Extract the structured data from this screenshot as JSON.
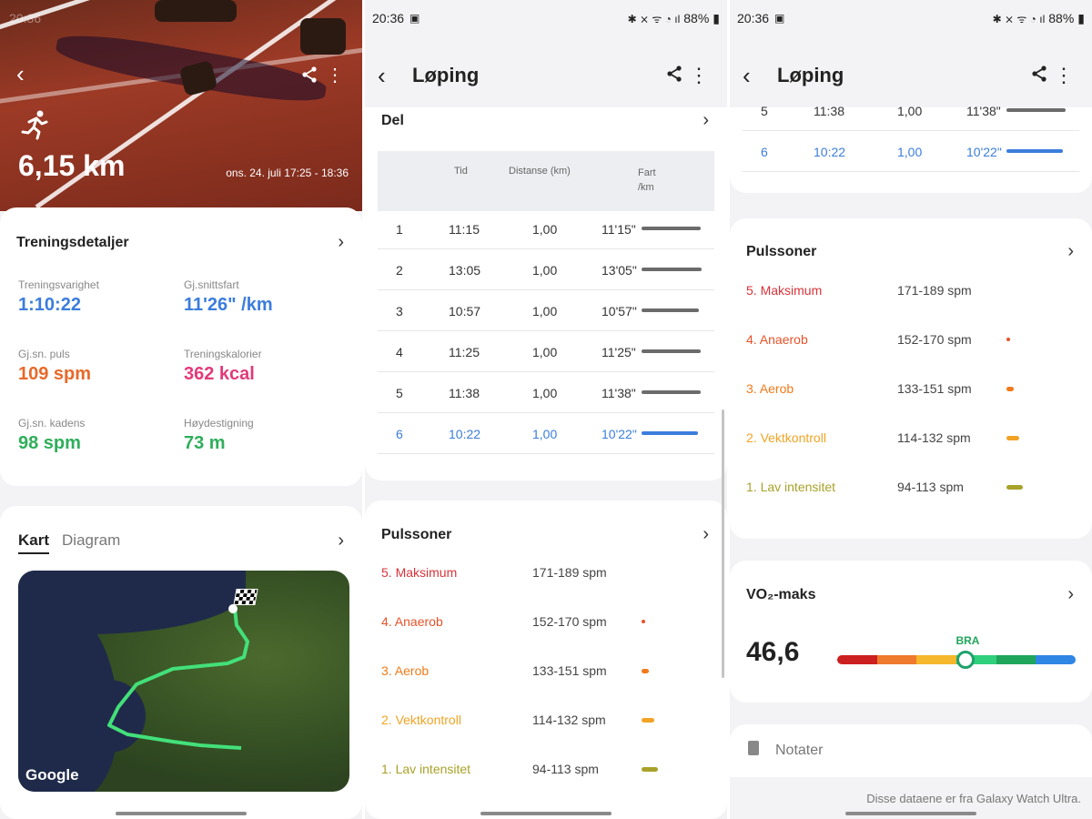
{
  "status_bar": {
    "time": "20:36",
    "battery": "88%"
  },
  "panel1": {
    "distance": "6,15 km",
    "datetime": "ons. 24. juli 17:25 - 18:36",
    "details_title": "Treningsdetaljer",
    "stats": [
      {
        "label": "Treningsvarighet",
        "value": "1:10:22",
        "color": "#3b7ddd"
      },
      {
        "label": "Gj.snittsfart",
        "value": "11'26\" /km",
        "color": "#3b7ddd"
      },
      {
        "label": "Gj.sn. puls",
        "value": "109 spm",
        "color": "#e8692a"
      },
      {
        "label": "Treningskalorier",
        "value": "362 kcal",
        "color": "#e23a7a"
      },
      {
        "label": "Gj.sn. kadens",
        "value": "98 spm",
        "color": "#2fae5b"
      },
      {
        "label": "Høydestigning",
        "value": "73 m",
        "color": "#2fae5b"
      }
    ],
    "tabs": [
      "Kart",
      "Diagram"
    ],
    "map_attribution": "Google"
  },
  "panel2": {
    "title": "Løping",
    "splits_title": "Del",
    "columns": [
      "Tid",
      "Distanse (km)",
      "Fart /km"
    ],
    "splits": [
      {
        "n": "1",
        "tid": "11:15",
        "dist": "1,00",
        "fart": "11'15\"",
        "pace_fraction": 0.85
      },
      {
        "n": "2",
        "tid": "13:05",
        "dist": "1,00",
        "fart": "13'05\"",
        "pace_fraction": 0.87
      },
      {
        "n": "3",
        "tid": "10:57",
        "dist": "1,00",
        "fart": "10'57\"",
        "pace_fraction": 0.83
      },
      {
        "n": "4",
        "tid": "11:25",
        "dist": "1,00",
        "fart": "11'25\"",
        "pace_fraction": 0.85
      },
      {
        "n": "5",
        "tid": "11:38",
        "dist": "1,00",
        "fart": "11'38\"",
        "pace_fraction": 0.86
      },
      {
        "n": "6",
        "tid": "10:22",
        "dist": "1,00",
        "fart": "10'22\"",
        "pace_fraction": 0.82
      }
    ],
    "highlight_color": "#3b7ddd",
    "zones_title": "Pulssoner"
  },
  "zones": [
    {
      "name": "5. Maksimum",
      "range": "171-189 spm",
      "color": "#d8333a"
    },
    {
      "name": "4. Anaerob",
      "range": "152-170 spm",
      "color": "#e5532a"
    },
    {
      "name": "3. Aerob",
      "range": "133-151 spm",
      "color": "#f07a1a"
    },
    {
      "name": "2. Vektkontroll",
      "range": "114-132 spm",
      "color": "#f1a325"
    },
    {
      "name": "1. Lav intensitet",
      "range": "94-113 spm",
      "color": "#a9a22a"
    }
  ],
  "panel3": {
    "title": "Løping",
    "vo2_title": "VO₂-maks",
    "vo2_value": "46,6",
    "vo2_rating": "BRA",
    "vo2_level_fraction": 0.54,
    "notes_label": "Notater",
    "source_note": "Disse dataene er fra Galaxy Watch Ultra."
  }
}
